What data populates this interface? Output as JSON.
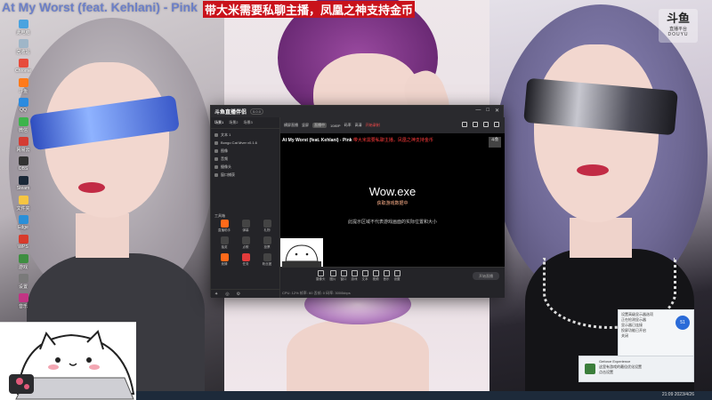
{
  "stream_overlay": {
    "song_title": "At My Worst (feat. Kehlani) - Pink",
    "promo": "带大米需要私聊主播，凤凰之神支持金币"
  },
  "douyu_logo": {
    "main": "斗鱼",
    "sub": "直播平台",
    "code": "DOUYU"
  },
  "desktop": {
    "icons": [
      {
        "label": "此电脑",
        "color": "#4aa3df"
      },
      {
        "label": "回收站",
        "color": "#9fb6c8"
      },
      {
        "label": "Chrome",
        "color": "#e74c3c"
      },
      {
        "label": "斗鱼",
        "color": "#ff7a1a"
      },
      {
        "label": "QQ",
        "color": "#2c8be0"
      },
      {
        "label": "微信",
        "color": "#3cb44b"
      },
      {
        "label": "网易云",
        "color": "#d43c33"
      },
      {
        "label": "OBS",
        "color": "#333333"
      },
      {
        "label": "Steam",
        "color": "#1b2838"
      },
      {
        "label": "文件夹",
        "color": "#f5c542"
      },
      {
        "label": "Edge",
        "color": "#2a8fd8"
      },
      {
        "label": "WPS",
        "color": "#d83b2c"
      },
      {
        "label": "游戏",
        "color": "#3e8e41"
      },
      {
        "label": "设置",
        "color": "#7a7a7a"
      },
      {
        "label": "音乐",
        "color": "#c13584"
      }
    ]
  },
  "app": {
    "logo": "斗鱼直播伴侣",
    "version": "5.0.0",
    "window_controls": [
      "—",
      "□",
      "✕"
    ],
    "sidebar_tabs": [
      "场景1",
      "场景2",
      "场景3"
    ],
    "sources": [
      {
        "label": "文本 1"
      },
      {
        "label": "Bongo Cat Mver v0.1.6"
      },
      {
        "label": "图像"
      },
      {
        "label": "音频"
      },
      {
        "label": "摄像头"
      },
      {
        "label": "窗口捕获"
      }
    ],
    "tools_title": "工具箱",
    "tools": [
      {
        "label": "直播助手",
        "style": "orange"
      },
      {
        "label": "弹幕",
        "style": ""
      },
      {
        "label": "礼物",
        "style": ""
      },
      {
        "label": "抽奖",
        "style": ""
      },
      {
        "label": "点歌",
        "style": ""
      },
      {
        "label": "投票",
        "style": ""
      },
      {
        "label": "竞猜",
        "style": "orange"
      },
      {
        "label": "任务",
        "style": "red"
      },
      {
        "label": "粉丝团",
        "style": ""
      }
    ],
    "sidebar_footer": [
      "✦",
      "◎",
      "⚙"
    ],
    "toolbar": {
      "items": [
        "横屏直播",
        "竖屏",
        "1080P",
        "码率",
        "高清",
        "开始录制",
        "帧率"
      ],
      "live_tag": "直播中"
    },
    "preview": {
      "title": "At My Worst (feat. Kehlani) - Pink",
      "title_suffix": "带大米需要私聊主播，凤凰之神支持金币",
      "corner_logo": "斗鱼",
      "game": "Wow.exe",
      "game_sub": "获取游戏数据中",
      "desc": "此提示区域不代表游戏画面的实际位置和大小"
    },
    "bottom_buttons": [
      "摄像头",
      "图片",
      "窗口",
      "游戏",
      "文本",
      "视频",
      "音乐",
      "设置"
    ],
    "start_live": "开始直播",
    "status": "CPU: 12%  帧率: 60  丢帧: 0  码率: 3000kbps"
  },
  "notifications": {
    "badge": "51",
    "lines": [
      "设置高级显示器选项",
      "正在检测显示器",
      "显示器已连接",
      "投屏功能已开启",
      "关闭"
    ],
    "toast_lines": [
      "Geforce Experience",
      "这里有游戏的最佳优化设置",
      "点击设置"
    ]
  },
  "taskbar": {
    "time": "21:09",
    "date": "2023/4/26"
  }
}
